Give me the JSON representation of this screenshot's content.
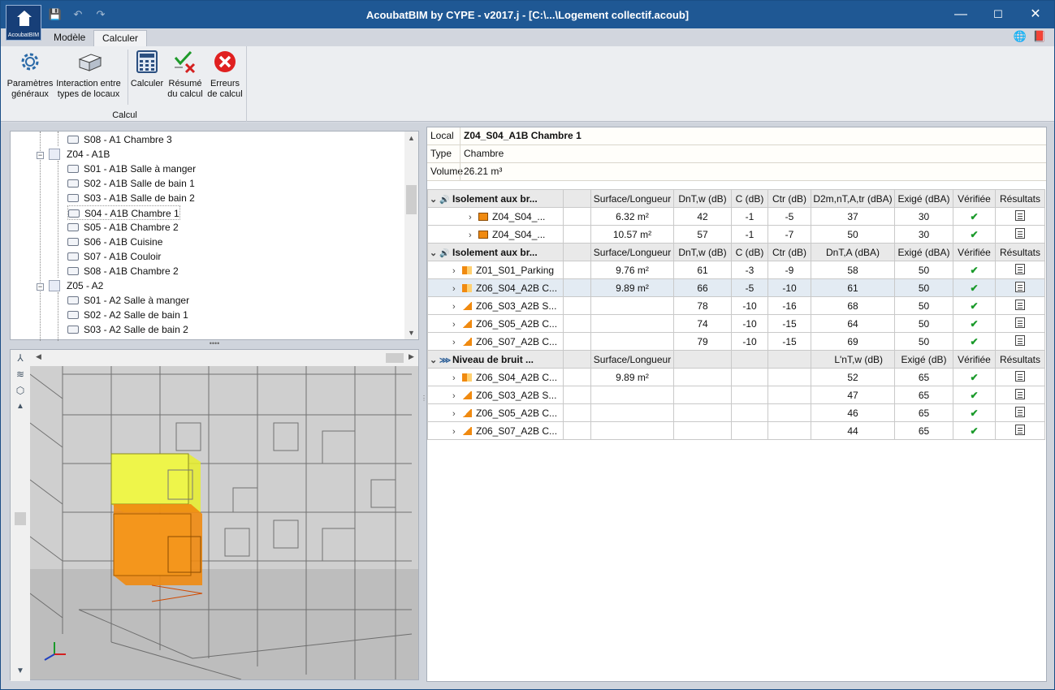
{
  "window": {
    "title": "AcoubatBIM by CYPE - v2017.j - [C:\\...\\Logement collectif.acoub]",
    "app_icon_label": "AcoubatBIM",
    "minimize": "—",
    "maximize": "☐",
    "close": "✕"
  },
  "quick_access": {
    "save": "💾",
    "undo": "↶",
    "redo": "↷"
  },
  "tabs": [
    {
      "label": "Modèle"
    },
    {
      "label": "Calculer"
    }
  ],
  "ribbon": {
    "group_label": "Calcul",
    "buttons": [
      {
        "label1": "Paramètres",
        "label2": "généraux",
        "icon": "gear-icon"
      },
      {
        "label1": "Interaction entre",
        "label2": "types de locaux",
        "icon": "blocks-icon"
      },
      {
        "label1": "Calculer",
        "label2": "",
        "icon": "calculator-icon"
      },
      {
        "label1": "Résumé",
        "label2": "du calcul",
        "icon": "check-cross-icon"
      },
      {
        "label1": "Erreurs",
        "label2": "de calcul",
        "icon": "error-icon"
      }
    ]
  },
  "tree": {
    "items": [
      {
        "label": "S08 - A1 Chambre 3",
        "level": 2
      },
      {
        "label": "Z04 - A1B",
        "level": 1
      },
      {
        "label": "S01 - A1B Salle à manger",
        "level": 2
      },
      {
        "label": "S02 - A1B Salle de bain 1",
        "level": 2
      },
      {
        "label": "S03 - A1B Salle de bain 2",
        "level": 2
      },
      {
        "label": "S04 - A1B Chambre 1",
        "level": 2
      },
      {
        "label": "S05 - A1B Chambre 2",
        "level": 2
      },
      {
        "label": "S06 - A1B Cuisine",
        "level": 2
      },
      {
        "label": "S07 - A1B Couloir",
        "level": 2
      },
      {
        "label": "S08 - A1B Chambre 2",
        "level": 2
      },
      {
        "label": "Z05 - A2",
        "level": 1
      },
      {
        "label": "S01 - A2 Salle à manger",
        "level": 2
      },
      {
        "label": "S02 - A2 Salle de bain 1",
        "level": 2
      },
      {
        "label": "S03 - A2 Salle de bain 2",
        "level": 2
      }
    ]
  },
  "local": {
    "local_label": "Local",
    "local_value": "Z04_S04_A1B Chambre 1",
    "type_label": "Type",
    "type_value": "Chambre",
    "volume_label": "Volume",
    "volume_value": "26.21  m³"
  },
  "sections": [
    {
      "title": "Isolement aux br...",
      "headers": [
        "Surface/Longueur",
        "DnT,w (dB)",
        "C (dB)",
        "Ctr (dB)",
        "D2m,nT,A,tr (dBA)",
        "Exigé (dBA)",
        "Vérifiée",
        "Résultats"
      ],
      "rows": [
        {
          "name": "Z04_S04_...",
          "surface": "6.32 m²",
          "dntw": "42",
          "c": "-1",
          "ctr": "-5",
          "d": "37",
          "exige": "30",
          "indent": true
        },
        {
          "name": "Z04_S04_...",
          "surface": "10.57 m²",
          "dntw": "57",
          "c": "-1",
          "ctr": "-7",
          "d": "50",
          "exige": "30",
          "indent": true
        }
      ]
    },
    {
      "title": "Isolement aux br...",
      "headers": [
        "Surface/Longueur",
        "DnT,w (dB)",
        "C (dB)",
        "Ctr (dB)",
        "DnT,A (dBA)",
        "Exigé (dBA)",
        "Vérifiée",
        "Résultats"
      ],
      "rows": [
        {
          "name": "Z01_S01_Parking",
          "surface": "9.76 m²",
          "dntw": "61",
          "c": "-3",
          "ctr": "-9",
          "d": "58",
          "exige": "50"
        },
        {
          "name": "Z06_S04_A2B C...",
          "surface": "9.89 m²",
          "dntw": "66",
          "c": "-5",
          "ctr": "-10",
          "d": "61",
          "exige": "50"
        },
        {
          "name": "Z06_S03_A2B S...",
          "surface": "",
          "dntw": "78",
          "c": "-10",
          "ctr": "-16",
          "d": "68",
          "exige": "50"
        },
        {
          "name": "Z06_S05_A2B C...",
          "surface": "",
          "dntw": "74",
          "c": "-10",
          "ctr": "-15",
          "d": "64",
          "exige": "50"
        },
        {
          "name": "Z06_S07_A2B C...",
          "surface": "",
          "dntw": "79",
          "c": "-10",
          "ctr": "-15",
          "d": "69",
          "exige": "50"
        }
      ]
    },
    {
      "title": "Niveau de bruit ...",
      "headers": [
        "Surface/Longueur",
        "",
        "",
        "",
        "L'nT,w (dB)",
        "Exigé (dB)",
        "Vérifiée",
        "Résultats"
      ],
      "rows": [
        {
          "name": "Z06_S04_A2B C...",
          "surface": "9.89 m²",
          "dntw": "",
          "c": "",
          "ctr": "",
          "d": "52",
          "exige": "65"
        },
        {
          "name": "Z06_S03_A2B S...",
          "surface": "",
          "dntw": "",
          "c": "",
          "ctr": "",
          "d": "47",
          "exige": "65"
        },
        {
          "name": "Z06_S05_A2B C...",
          "surface": "",
          "dntw": "",
          "c": "",
          "ctr": "",
          "d": "46",
          "exige": "65"
        },
        {
          "name": "Z06_S07_A2B C...",
          "surface": "",
          "dntw": "",
          "c": "",
          "ctr": "",
          "d": "44",
          "exige": "65"
        }
      ]
    }
  ],
  "colors": {
    "titlebar": "#1f5894",
    "accent_yellow": "#e8ef2a",
    "accent_orange": "#f08a10",
    "check": "#1a9a2a"
  }
}
